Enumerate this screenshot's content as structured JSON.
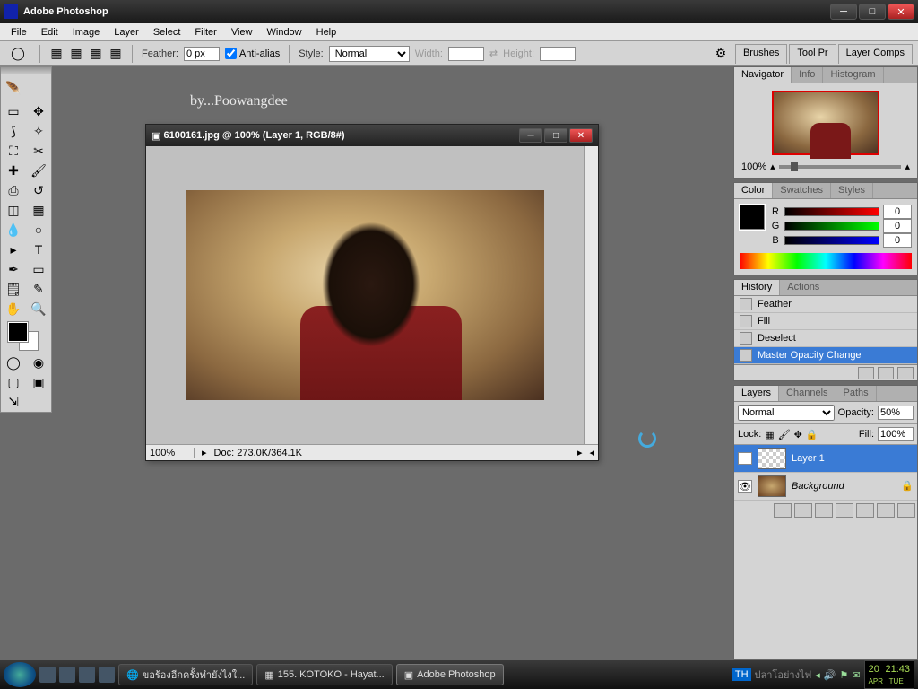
{
  "app": {
    "title": "Adobe Photoshop"
  },
  "menu": [
    "File",
    "Edit",
    "Image",
    "Layer",
    "Select",
    "Filter",
    "View",
    "Window",
    "Help"
  ],
  "options": {
    "feather_label": "Feather:",
    "feather_value": "0 px",
    "antialias_label": "Anti-alias",
    "style_label": "Style:",
    "style_value": "Normal",
    "width_label": "Width:",
    "height_label": "Height:",
    "tabs": [
      "Brushes",
      "Tool Pr",
      "Layer Comps"
    ]
  },
  "watermark": "by...Poowangdee",
  "document": {
    "title": "6100161.jpg @ 100% (Layer 1, RGB/8#)",
    "zoom": "100%",
    "doc_info": "Doc: 273.0K/364.1K"
  },
  "navigator": {
    "tab1": "Navigator",
    "tab2": "Info",
    "tab3": "Histogram",
    "zoom": "100%"
  },
  "color": {
    "tab1": "Color",
    "tab2": "Swatches",
    "tab3": "Styles",
    "r": "R",
    "g": "G",
    "b": "B",
    "r_val": "0",
    "g_val": "0",
    "b_val": "0"
  },
  "history": {
    "tab1": "History",
    "tab2": "Actions",
    "items": [
      "Feather",
      "Fill",
      "Deselect",
      "Master Opacity Change"
    ]
  },
  "layers": {
    "tab1": "Layers",
    "tab2": "Channels",
    "tab3": "Paths",
    "blend": "Normal",
    "opacity_label": "Opacity:",
    "opacity": "50%",
    "lock_label": "Lock:",
    "fill_label": "Fill:",
    "fill": "100%",
    "rows": [
      {
        "name": "Layer 1",
        "active": true
      },
      {
        "name": "Background",
        "active": false,
        "locked": true
      }
    ]
  },
  "taskbar": {
    "items": [
      "ขอร้องอีกครั้งทำยังไงใ...",
      "155. KOTOKO - Hayat...",
      "Adobe Photoshop"
    ],
    "tray_text": "ปลาโอย่างไฟ",
    "clock": "21:43",
    "date_day": "20",
    "date_mon": "APR",
    "date_dow": "TUE"
  }
}
